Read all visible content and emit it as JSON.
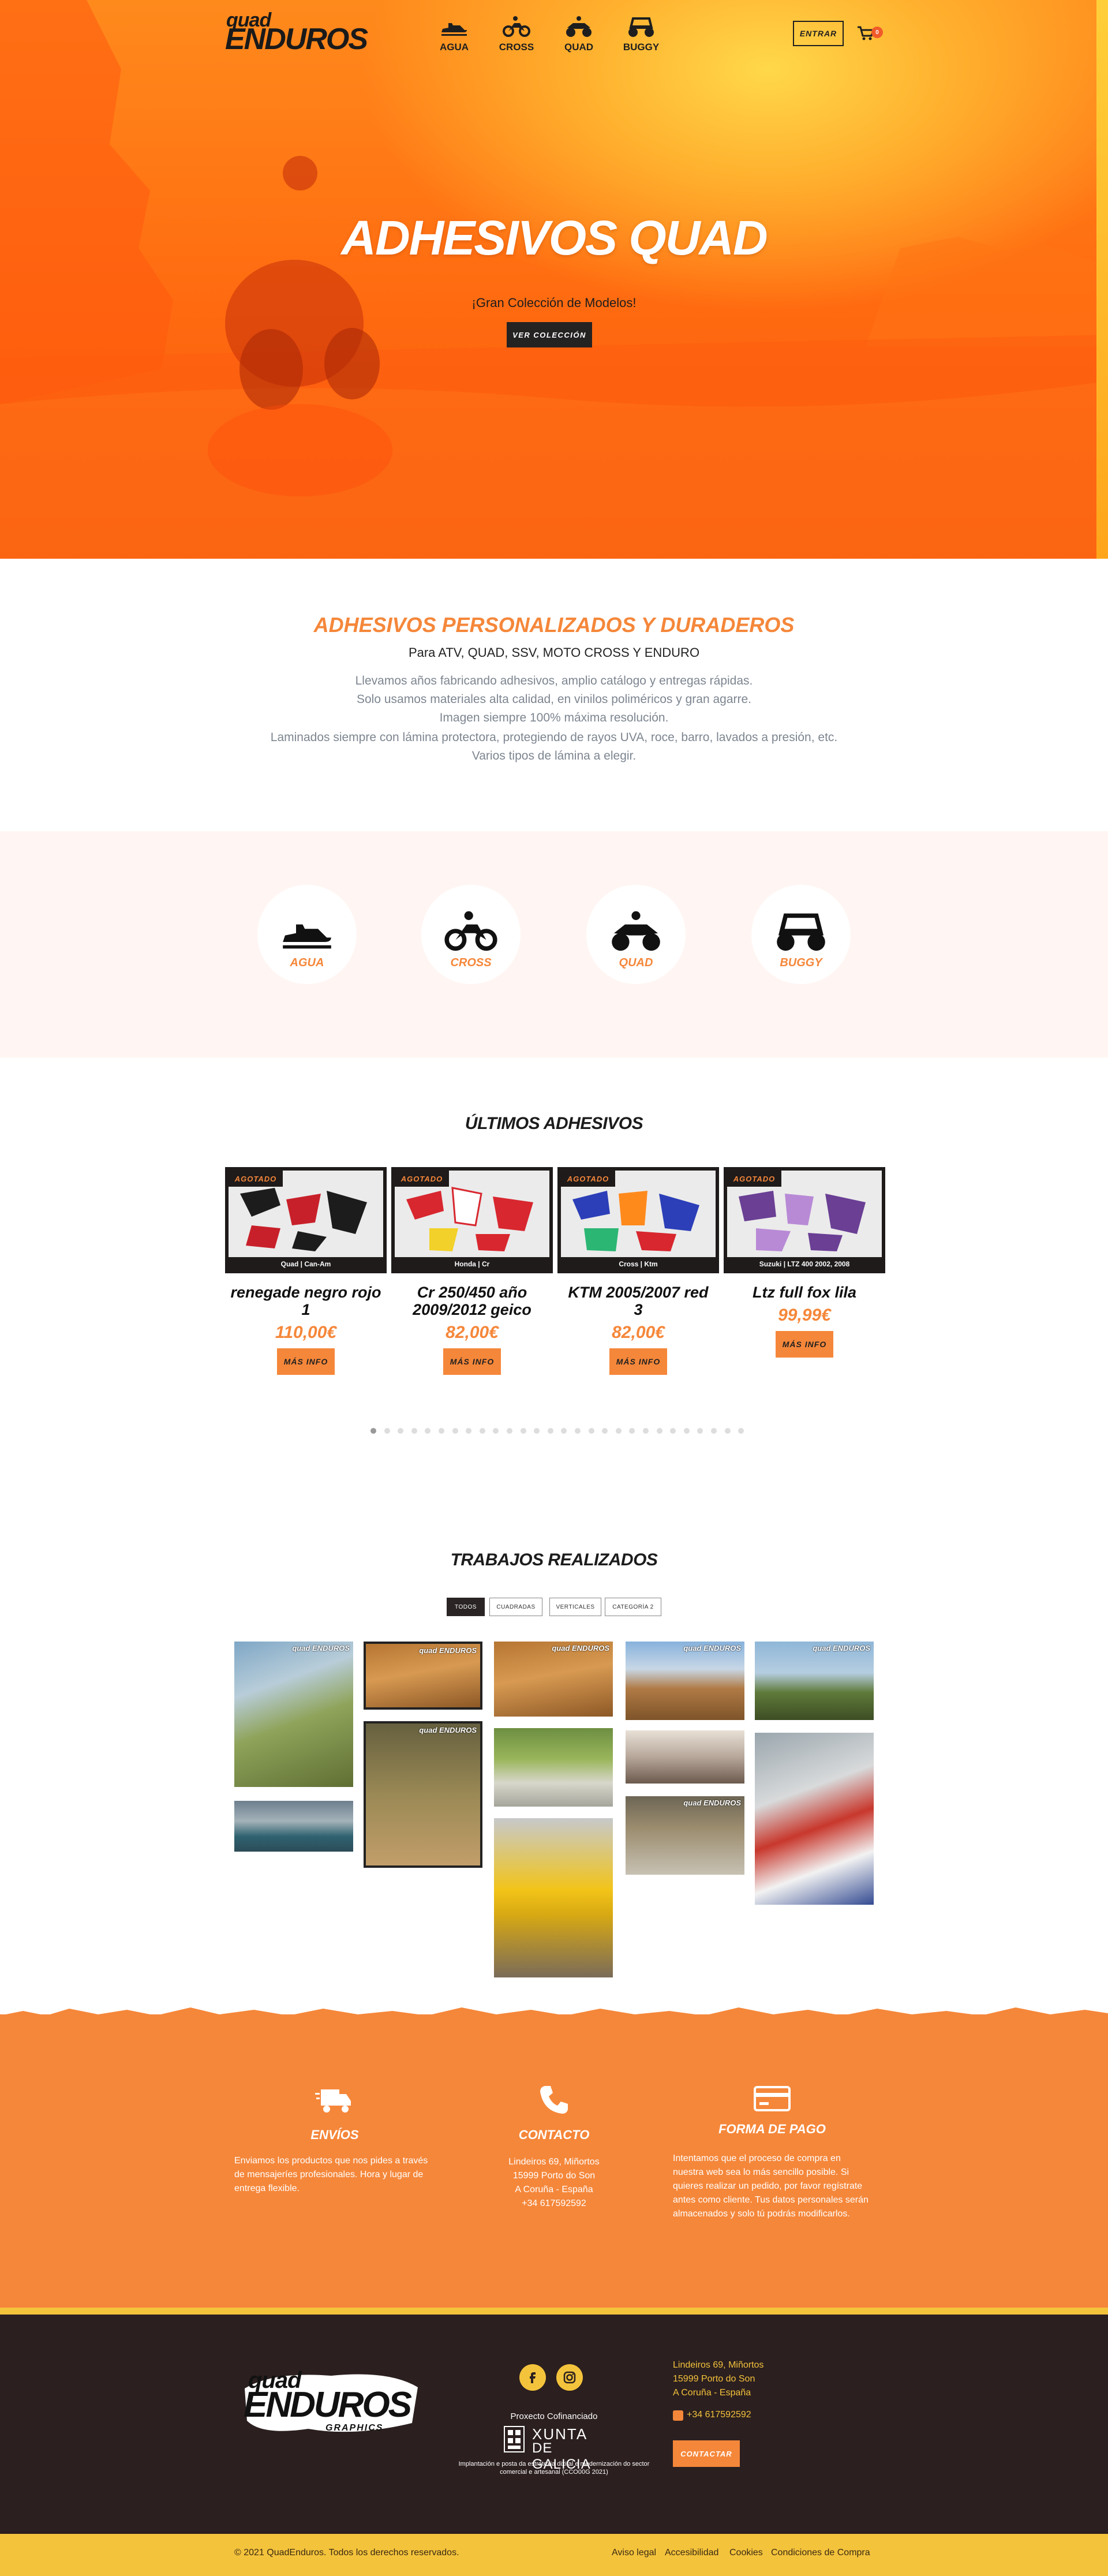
{
  "header": {
    "logo_line1": "quad",
    "logo_line2": "ENDUROS",
    "nav": [
      {
        "label": "AGUA",
        "icon": "jetski-icon"
      },
      {
        "label": "CROSS",
        "icon": "motocross-icon"
      },
      {
        "label": "QUAD",
        "icon": "quad-icon"
      },
      {
        "label": "BUGGY",
        "icon": "buggy-icon"
      }
    ],
    "login_label": "ENTRAR",
    "cart_icon": "cart-icon",
    "cart_count": "0"
  },
  "hero": {
    "title": "ADHESIVOS QUAD",
    "subtitle": "¡Gran Colección de Modelos!",
    "button": "VER COLECCIÓN"
  },
  "intro": {
    "title": "ADHESIVOS PERSONALIZADOS Y DURADEROS",
    "subtitle": "Para ATV, QUAD, SSV, MOTO CROSS Y ENDURO",
    "lines": [
      "Llevamos años fabricando adhesivos, amplio catálogo y entregas rápidas.",
      "Solo usamos materiales alta calidad, en vinilos poliméricos y gran agarre.",
      "Imagen siempre 100% máxima resolución.",
      "Laminados siempre con lámina protectora, protegiendo de rayos UVA, roce, barro, lavados a presión, etc.",
      "Varios tipos de lámina a elegir."
    ]
  },
  "categories": [
    {
      "label": "AGUA"
    },
    {
      "label": "CROSS"
    },
    {
      "label": "QUAD"
    },
    {
      "label": "BUGGY"
    }
  ],
  "latest": {
    "title": "ÚLTIMOS ADHESIVOS",
    "products": [
      {
        "badge": "AGOTADO",
        "brand_line": "Quad  |  Can-Am",
        "name": "renegade negro rojo 1",
        "price": "110,00€",
        "button": "MÁS INFO"
      },
      {
        "badge": "AGOTADO",
        "brand_line": "Honda  |  Cr",
        "name": "Cr 250/450 año 2009/2012 geico",
        "price": "82,00€",
        "button": "MÁS INFO"
      },
      {
        "badge": "AGOTADO",
        "brand_line": "Cross  |  Ktm",
        "name": "KTM 2005/2007 red 3",
        "price": "82,00€",
        "button": "MÁS INFO"
      },
      {
        "badge": "AGOTADO",
        "brand_line": "Suzuki  |  LTZ 400 2002, 2008",
        "name": "Ltz full fox lila",
        "price": "99,99€",
        "button": "MÁS INFO"
      }
    ]
  },
  "works": {
    "title": "TRABAJOS REALIZADOS",
    "filters": [
      "TODOS",
      "CUADRADAS",
      "VERTICALES",
      "CATEGORÍA 2"
    ],
    "watermark": "quad ENDUROS"
  },
  "features": [
    {
      "icon": "truck-icon",
      "title": "ENVÍOS",
      "text": "Enviamos los productos que nos pides a través de mensajeríes profesionales. Hora y lugar de entrega flexible."
    },
    {
      "icon": "phone-icon",
      "title": "CONTACTO",
      "lines": [
        "Lindeiros 69, Miñortos",
        "15999 Porto do Son",
        "A Coruña - España",
        "+34 617592592"
      ]
    },
    {
      "icon": "card-icon",
      "title": "FORMA DE PAGO",
      "text": "Intentamos que el proceso de compra en nuestra web sea lo más sencillo posible. Si quieres realizar un pedido, por favor regístrate antes como cliente. Tus datos personales serán almacenados y solo tú podrás modificarlos."
    }
  ],
  "footer": {
    "logo_line1": "quad",
    "logo_line2": "ENDUROS",
    "logo_line3": "GRAPHICS",
    "social": [
      "facebook-icon",
      "instagram-icon"
    ],
    "cofunded": "Proxecto Cofinanciado",
    "xunta_line1": "XUNTA",
    "xunta_line2": "DE GALICIA",
    "xunta_note": "Implantación e posta da estratexia dixital e modernización do sector comercial e artesanal (CCO00G 2021)",
    "address": [
      "Lindeiros 69, Miñortos",
      "15999 Porto do Son",
      "A Coruña - España"
    ],
    "phone": "+34 617592592",
    "contact_button": "CONTACTAR",
    "copyright": "© 2021 QuadEnduros. Todos los derechos reservados.",
    "links": [
      "Aviso legal",
      "Accesibilidad",
      "Cookies",
      "Condiciones de Compra"
    ]
  },
  "colors": {
    "accent": "#f5873a",
    "dark": "#2b1f1f",
    "yellow": "#f4c33c"
  }
}
